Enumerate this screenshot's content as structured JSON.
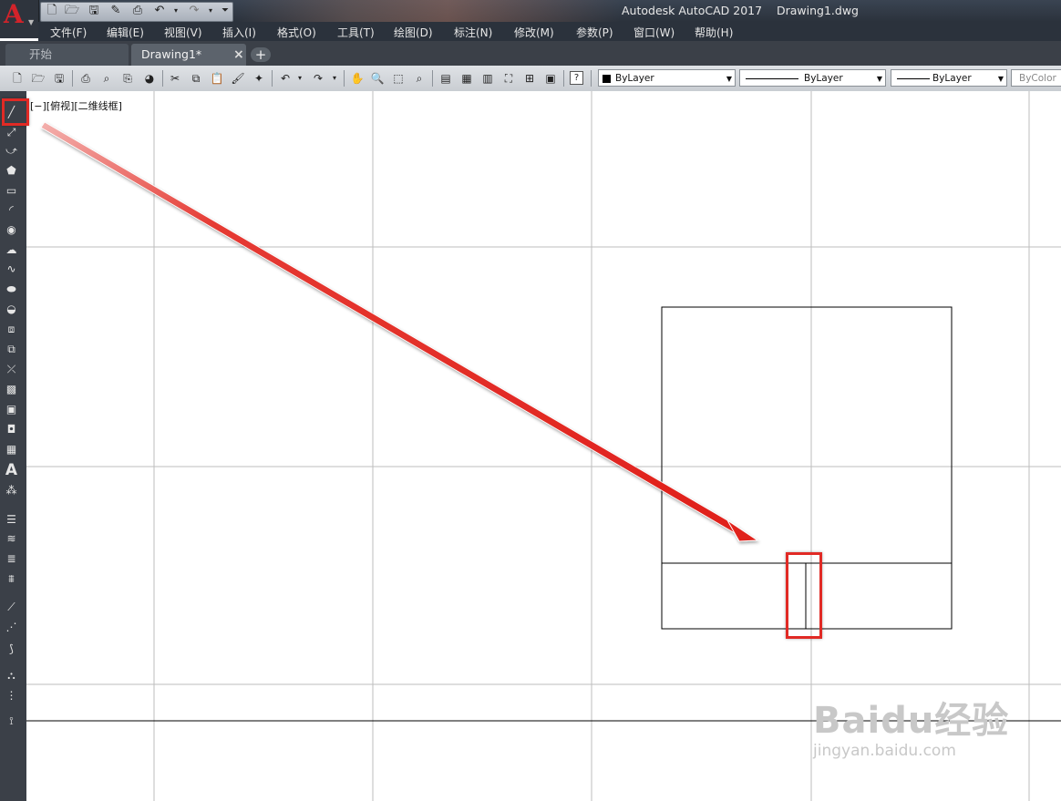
{
  "window": {
    "title": "Autodesk AutoCAD 2017    Drawing1.dwg"
  },
  "app": {
    "logo": "A"
  },
  "menu": [
    {
      "label": "文件(F)"
    },
    {
      "label": "编辑(E)"
    },
    {
      "label": "视图(V)"
    },
    {
      "label": "插入(I)"
    },
    {
      "label": "格式(O)"
    },
    {
      "label": "工具(T)"
    },
    {
      "label": "绘图(D)"
    },
    {
      "label": "标注(N)"
    },
    {
      "label": "修改(M)"
    },
    {
      "label": "参数(P)"
    },
    {
      "label": "窗口(W)"
    },
    {
      "label": "帮助(H)"
    }
  ],
  "tabs": [
    {
      "label": "开始"
    },
    {
      "label": "Drawing1*"
    }
  ],
  "tab_close": "×",
  "tab_add": "+",
  "toolbar": {
    "color": "ByLayer",
    "linetype": "ByLayer",
    "lineweight": "ByLayer",
    "plotstyle": "ByColor"
  },
  "viewport_label": "[−][俯视][二维线框]",
  "watermark": {
    "logo": "Baidu经验",
    "url": "jingyan.baidu.com"
  },
  "colors": {
    "highlight": "#e12a25",
    "titlebar": "#2b323c",
    "drawing_line": "#000000"
  }
}
